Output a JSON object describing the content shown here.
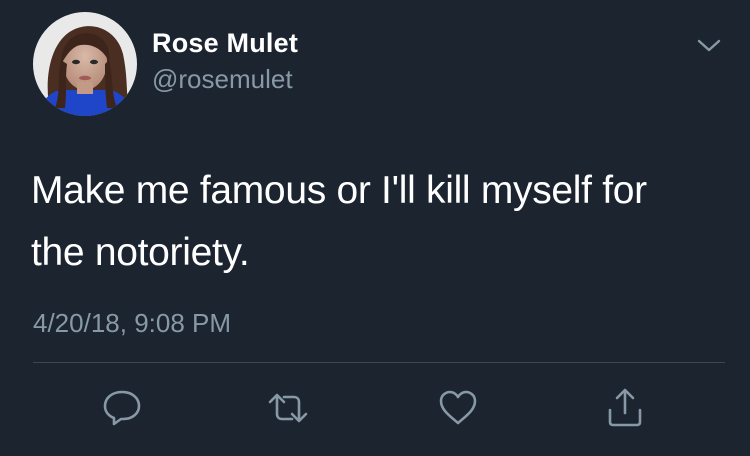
{
  "tweet": {
    "author": {
      "display_name": "Rose Mulet",
      "handle": "@rosemulet"
    },
    "text_lines": [
      "Make me famous or I'll kill myself for",
      "the notoriety."
    ],
    "timestamp": "4/20/18, 9:08 PM"
  },
  "actions": [
    {
      "name": "reply",
      "icon": "speech-bubble-icon"
    },
    {
      "name": "retweet",
      "icon": "retweet-icon"
    },
    {
      "name": "like",
      "icon": "heart-icon"
    },
    {
      "name": "share",
      "icon": "share-icon"
    }
  ],
  "colors": {
    "background": "#1c2430",
    "text_primary": "#ffffff",
    "text_secondary": "#8899a6",
    "divider": "#3d4753"
  }
}
